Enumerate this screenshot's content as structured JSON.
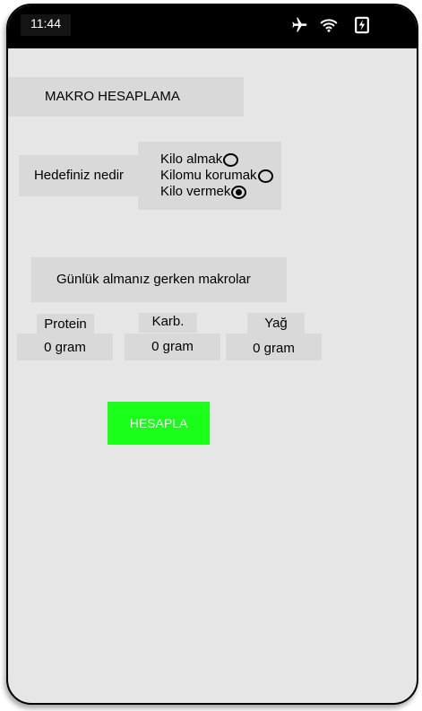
{
  "status_bar": {
    "time": "11:44",
    "icons": [
      "airplane-icon",
      "wifi-icon",
      "battery-charging-icon"
    ]
  },
  "app": {
    "title": "MAKRO HESAPLAMA",
    "goal": {
      "label": "Hedefiniz nedir",
      "options": [
        {
          "label": "Kilo almak",
          "selected": false
        },
        {
          "label": "Kilomu korumak",
          "selected": false
        },
        {
          "label": "Kilo vermek",
          "selected": true
        }
      ]
    },
    "macros": {
      "heading": "Günlük almanız gerken makrolar",
      "protein": {
        "label": "Protein",
        "value": "0 gram"
      },
      "carbs": {
        "label": "Karb.",
        "value": "0 gram"
      },
      "fat": {
        "label": "Yağ",
        "value": "0 gram"
      }
    },
    "calculate_button": "HESAPLA"
  },
  "colors": {
    "background": "#e6e6e6",
    "box": "#d9d9d9",
    "button": "#1aff1a",
    "status_bar": "#000000"
  }
}
